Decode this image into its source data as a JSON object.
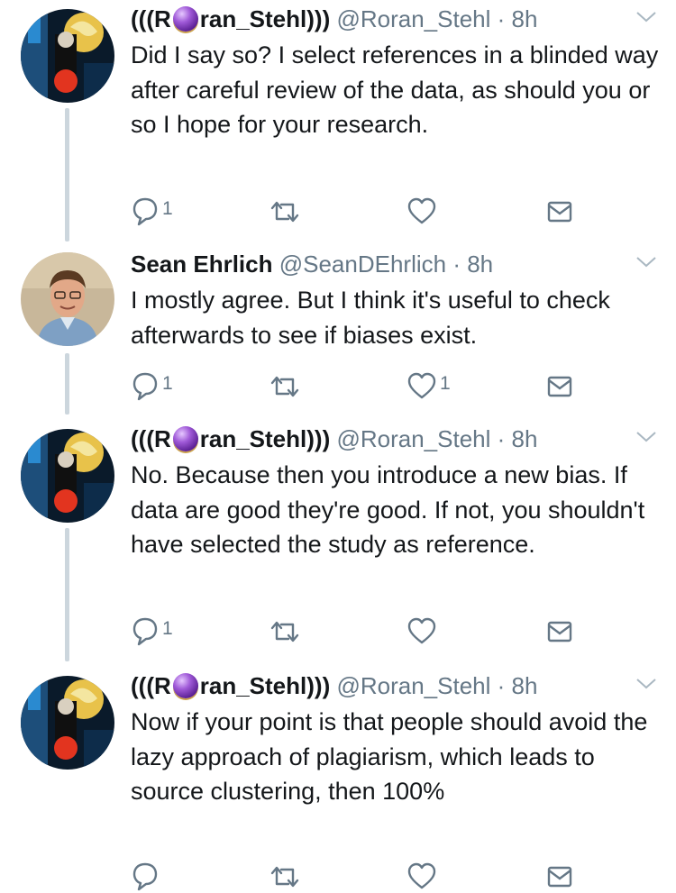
{
  "tweets": [
    {
      "name": "(((R",
      "name_after": "ran_Stehl)))",
      "handle": "@Roran_Stehl",
      "time": "· 8h",
      "text": "Did I say so? I select references in a blinded way after careful review of the data, as should you or so I hope for your research.",
      "reply_count": "1",
      "retweet_count": "",
      "like_count": ""
    },
    {
      "name": "Sean Ehrlich",
      "name_after": "",
      "handle": "@SeanDEhrlich",
      "time": "· 8h",
      "text": "I mostly agree. But I think it's useful to check afterwards to see if biases exist.",
      "reply_count": "1",
      "retweet_count": "",
      "like_count": "1"
    },
    {
      "name": "(((R",
      "name_after": "ran_Stehl)))",
      "handle": "@Roran_Stehl",
      "time": "· 8h",
      "text": "No. Because then you introduce a new bias. If data are good they're good. If not, you shouldn't have selected the study as reference.",
      "reply_count": "1",
      "retweet_count": "",
      "like_count": ""
    },
    {
      "name": "(((R",
      "name_after": "ran_Stehl)))",
      "handle": "@Roran_Stehl",
      "time": "· 8h",
      "text": "Now if your point is that people should avoid the lazy approach of plagiarism, which leads to source clustering, then 100%",
      "reply_count": "",
      "retweet_count": "",
      "like_count": ""
    }
  ],
  "colors": {
    "text": "#14171a",
    "secondary": "#657786",
    "thread_line": "#ccd6dd",
    "icon": "#657786"
  },
  "icons": [
    "reply-icon",
    "retweet-icon",
    "like-icon",
    "direct-message-icon",
    "chevron-down-icon",
    "crystal-ball-emoji"
  ]
}
